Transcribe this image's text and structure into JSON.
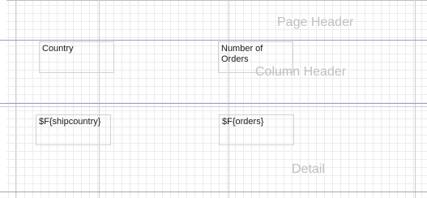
{
  "bands": {
    "page_header": "Page Header",
    "column_header": "Column Header",
    "detail": "Detail"
  },
  "column_header_fields": {
    "country": "Country",
    "number_of_orders": "Number of Orders"
  },
  "detail_fields": {
    "shipcountry": "$F{shipcountry}",
    "orders": "$F{orders}"
  },
  "colors": {
    "band_line": "#9a9ad6",
    "grid": "#ececec",
    "band_label": "#c0c0c0"
  }
}
